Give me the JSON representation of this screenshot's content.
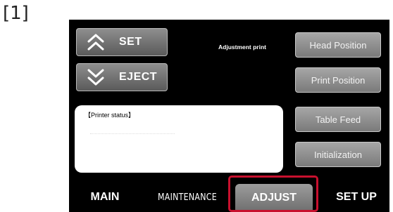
{
  "figure_label": "[1]",
  "left_buttons": {
    "set_label": "SET",
    "eject_label": "EJECT",
    "set_icon": "chevron-double-up-icon",
    "eject_icon": "chevron-double-down-icon"
  },
  "adjustment_print_label": "Adjustment print",
  "right_buttons": [
    {
      "label": "Head Position"
    },
    {
      "label": "Print Position"
    },
    {
      "label": "Table Feed"
    },
    {
      "label": "Initialization"
    }
  ],
  "status": {
    "title": "【Printer status】"
  },
  "tabs": [
    {
      "label": "MAIN"
    },
    {
      "label": "MAINTENANCE"
    },
    {
      "label": "ADJUST",
      "selected": true
    },
    {
      "label": "SET UP"
    }
  ],
  "colors": {
    "highlight": "#c8102e",
    "panel_background": "#000000"
  }
}
